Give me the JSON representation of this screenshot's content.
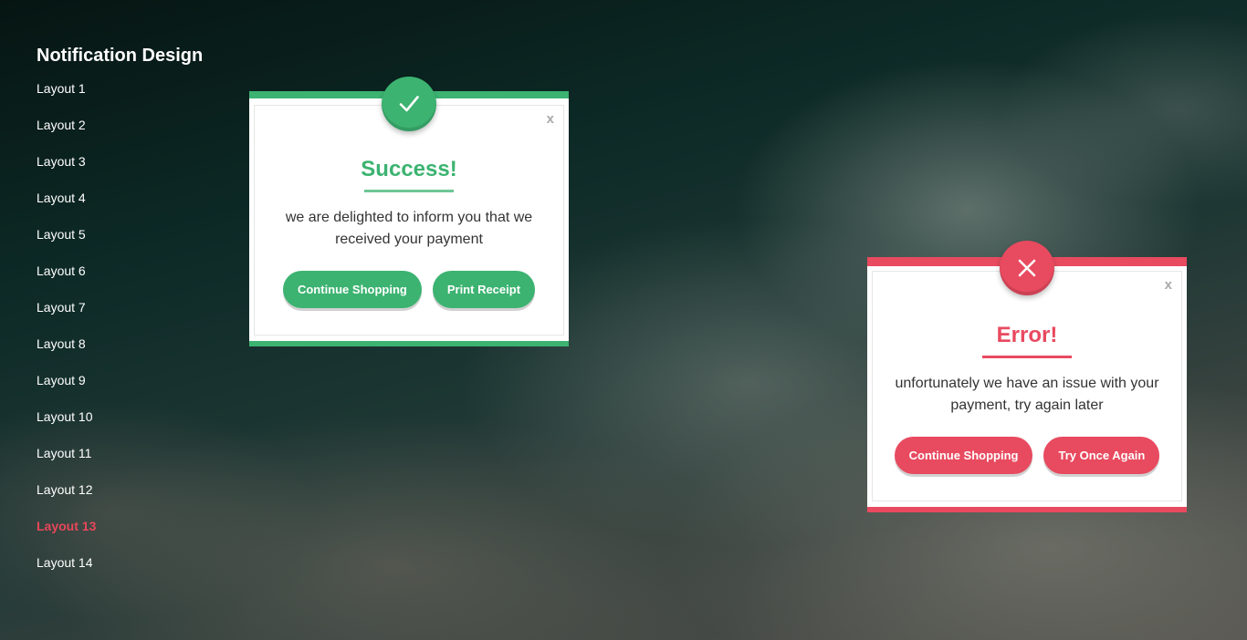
{
  "sidebar": {
    "title": "Notification Design",
    "items": [
      {
        "label": "Layout 1"
      },
      {
        "label": "Layout 2"
      },
      {
        "label": "Layout 3"
      },
      {
        "label": "Layout 4"
      },
      {
        "label": "Layout 5"
      },
      {
        "label": "Layout 6"
      },
      {
        "label": "Layout 7"
      },
      {
        "label": "Layout 8"
      },
      {
        "label": "Layout 9"
      },
      {
        "label": "Layout 10"
      },
      {
        "label": "Layout 11"
      },
      {
        "label": "Layout 12"
      },
      {
        "label": "Layout 13",
        "active": true
      },
      {
        "label": "Layout 14"
      }
    ]
  },
  "success_card": {
    "icon": "checkmark-icon",
    "close_label": "x",
    "title": "Success!",
    "message": "we are delighted to inform you that we received your payment",
    "primary_button": "Continue Shopping",
    "secondary_button": "Print Receipt",
    "color": "#3cb371"
  },
  "error_card": {
    "icon": "cross-icon",
    "close_label": "x",
    "title": "Error!",
    "message": "unfortunately we have an issue with your payment, try again later",
    "primary_button": "Continue Shopping",
    "secondary_button": "Try Once Again",
    "color": "#e84a5f"
  },
  "colors": {
    "active_menu": "#e8475a"
  }
}
